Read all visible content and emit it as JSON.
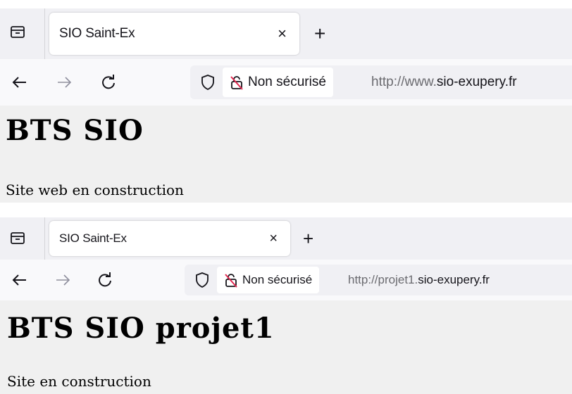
{
  "windows": [
    {
      "tab": {
        "title": "SIO Saint-Ex",
        "close": "×"
      },
      "new_tab": "+",
      "security_label": "Non sécurisé",
      "url": {
        "prefix": "http://www.",
        "host": "sio-exupery.fr"
      },
      "page": {
        "heading": "BTS SIO",
        "text": "Site web en construction"
      }
    },
    {
      "tab": {
        "title": "SIO Saint-Ex",
        "close": "×"
      },
      "new_tab": "+",
      "security_label": "Non sécurisé",
      "url": {
        "prefix": "http://projet1.",
        "host": "sio-exupery.fr"
      },
      "page": {
        "heading": "BTS SIO projet1",
        "text": "Site en construction"
      }
    }
  ]
}
